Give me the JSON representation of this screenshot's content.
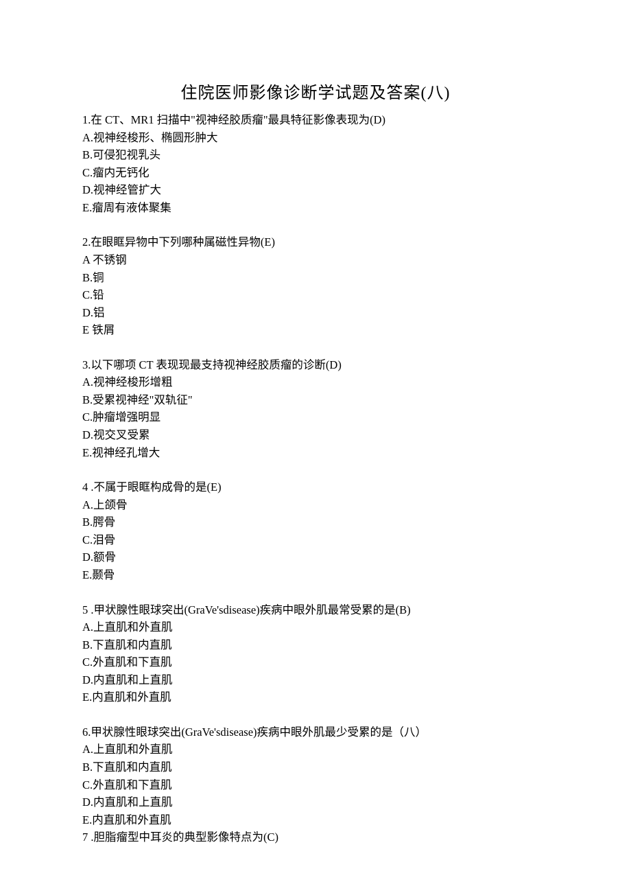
{
  "title": "住院医师影像诊断学试题及答案(八)",
  "questions": [
    {
      "stem": "1.在 CT、MR1 扫描中\"视神经胶质瘤\"最具特征影像表现为(D)",
      "options": [
        "A.视神经梭形、椭圆形肿大",
        "B.可侵犯视乳头",
        "C.瘤内无钙化",
        "D.视神经管扩大",
        "E.瘤周有液体聚集"
      ]
    },
    {
      "stem": "2.在眼眶异物中下列哪种属磁性异物(E)",
      "options": [
        "A 不锈钢",
        "B.铜",
        "C.铅",
        "D.铝",
        "E 铁屑"
      ]
    },
    {
      "stem": "3.以下哪项 CT 表现现最支持视神经胶质瘤的诊断(D)",
      "options": [
        "A.视神经梭形增粗",
        "B.受累视神经\"双轨征\"",
        "C.肿瘤增强明显",
        "D.视交叉受累",
        "E.视神经孔增大"
      ]
    },
    {
      "stem": "4 .不属于眼眶构成骨的是(E)",
      "options": [
        "A.上颌骨",
        "B.腭骨",
        "C.泪骨",
        "D.额骨",
        "E.颞骨"
      ]
    },
    {
      "stem": "5 .甲状腺性眼球突出(GraVe'sdisease)疾病中眼外肌最常受累的是(B)",
      "options": [
        "A.上直肌和外直肌",
        "B.下直肌和内直肌",
        "C.外直肌和下直肌",
        "D.内直肌和上直肌",
        "E.内直肌和外直肌"
      ]
    },
    {
      "stem": "6.甲状腺性眼球突出(GraVe'sdisease)疾病中眼外肌最少受累的是（八）",
      "options": [
        "A.上直肌和外直肌",
        "B.下直肌和内直肌",
        "C.外直肌和下直肌",
        "D.内直肌和上直肌",
        "E.内直肌和外直肌"
      ]
    },
    {
      "stem": "7 .胆脂瘤型中耳炎的典型影像特点为(C)",
      "options": []
    }
  ]
}
